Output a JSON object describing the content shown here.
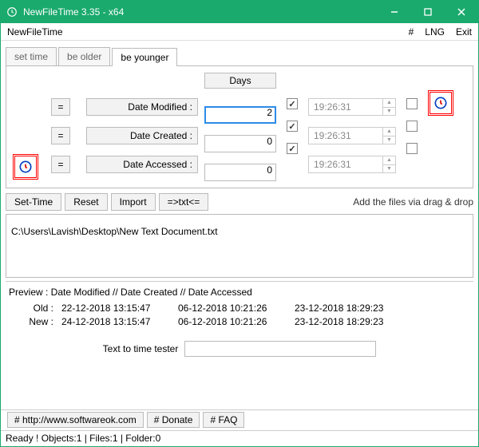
{
  "titlebar": {
    "title": "NewFileTime 3.35 - x64"
  },
  "menurow": {
    "app": "NewFileTime",
    "hash": "#",
    "lng": "LNG",
    "exit": "Exit"
  },
  "tabs": {
    "set_time": "set time",
    "be_older": "be older",
    "be_younger": "be younger"
  },
  "panel": {
    "days_header": "Days",
    "eq": "=",
    "rows": {
      "modified": {
        "label": "Date Modified :",
        "value": "2",
        "time": "19:26:31"
      },
      "created": {
        "label": "Date Created :",
        "value": "0",
        "time": "19:26:31"
      },
      "accessed": {
        "label": "Date Accessed :",
        "value": "0",
        "time": "19:26:31"
      }
    }
  },
  "btnrow": {
    "set_time": "Set-Time",
    "reset": "Reset",
    "import": "Import",
    "txt": "=>txt<=",
    "drag": "Add the files via drag & drop"
  },
  "filelist": {
    "path": "C:\\Users\\Lavish\\Desktop\\New Text Document.txt"
  },
  "preview": {
    "header": "Preview  :    Date Modified    //    Date Created    //    Date Accessed",
    "old_label": "Old :",
    "new_label": "New :",
    "old": {
      "modified": "22-12-2018 13:15:47",
      "created": "06-12-2018 10:21:26",
      "accessed": "23-12-2018 18:29:23"
    },
    "new": {
      "modified": "24-12-2018 13:15:47",
      "created": "06-12-2018 10:21:26",
      "accessed": "23-12-2018 18:29:23"
    }
  },
  "ttt": {
    "label": "Text to time tester"
  },
  "bottom": {
    "url": "# http://www.softwareok.com",
    "donate": "# Donate",
    "faq": "# FAQ"
  },
  "status": {
    "text": "Ready ! Objects:1 | Files:1 | Folder:0"
  }
}
